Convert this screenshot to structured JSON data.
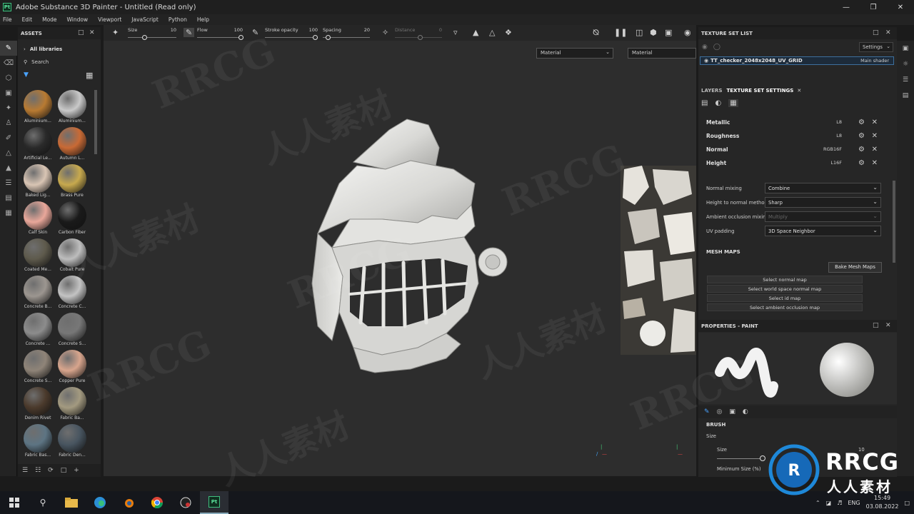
{
  "window": {
    "title": "Adobe Substance 3D Painter - Untitled (Read only)",
    "app_icon": "Pt"
  },
  "menu": [
    "File",
    "Edit",
    "Mode",
    "Window",
    "Viewport",
    "JavaScript",
    "Python",
    "Help"
  ],
  "toolbar": {
    "size_label": "Size",
    "size_value": "10",
    "flow_label": "Flow",
    "flow_value": "100",
    "stroke_opacity_label": "Stroke opacity",
    "stroke_opacity_value": "100",
    "spacing_label": "Spacing",
    "spacing_value": "20",
    "distance_label": "Distance",
    "distance_value": "0"
  },
  "viewport": {
    "material_select_3d": "Material",
    "material_select_2d": "Material"
  },
  "assets": {
    "title": "ASSETS",
    "libraries_label": "All libraries",
    "search_placeholder": "Search",
    "items": [
      {
        "label": "Aluminium...",
        "color": "#b87a32"
      },
      {
        "label": "Aluminium...",
        "color": "#c9c9c9"
      },
      {
        "label": "Artificial Le...",
        "color": "#2a2a2a"
      },
      {
        "label": "Autumn L...",
        "color": "#c96a35"
      },
      {
        "label": "Baked Lig...",
        "color": "#d9c5b4"
      },
      {
        "label": "Brass Pure",
        "color": "#c7a94e"
      },
      {
        "label": "Calf Skin",
        "color": "#e9a79a"
      },
      {
        "label": "Carbon Fiber",
        "color": "#1a1a1a"
      },
      {
        "label": "Coated Me...",
        "color": "#5e5a4c"
      },
      {
        "label": "Cobalt Pure",
        "color": "#bdbdbd"
      },
      {
        "label": "Concrete B...",
        "color": "#9c9690"
      },
      {
        "label": "Concrete C...",
        "color": "#c3c3c3"
      },
      {
        "label": "Concrete ...",
        "color": "#8c8c8c"
      },
      {
        "label": "Concrete S...",
        "color": "#777777"
      },
      {
        "label": "Concrete S...",
        "color": "#8f8478"
      },
      {
        "label": "Copper Pure",
        "color": "#d8a58d"
      },
      {
        "label": "Denim Rivet",
        "color": "#4b3a2c"
      },
      {
        "label": "Fabric Ba...",
        "color": "#a39a80"
      },
      {
        "label": "Fabric Bas...",
        "color": "#5d7483"
      },
      {
        "label": "Fabric Den...",
        "color": "#485560"
      }
    ]
  },
  "texture_set_list": {
    "title": "TEXTURE SET LIST",
    "settings_label": "Settings",
    "item_name": "TT_checker_2048x2048_UV_GRID",
    "item_shader": "Main shader"
  },
  "tabs": {
    "layers": "LAYERS",
    "texture_set_settings": "TEXTURE SET SETTINGS"
  },
  "channels": [
    {
      "name": "Metallic",
      "format": "L8"
    },
    {
      "name": "Roughness",
      "format": "L8"
    },
    {
      "name": "Normal",
      "format": "RGB16F"
    },
    {
      "name": "Height",
      "format": "L16F"
    }
  ],
  "properties": {
    "normal_mixing_label": "Normal mixing",
    "normal_mixing_value": "Combine",
    "height_to_normal_label": "Height to normal method",
    "height_to_normal_value": "Sharp",
    "ao_mixing_label": "Ambient occlusion mixing",
    "ao_mixing_value": "Multiply",
    "uv_padding_label": "UV padding",
    "uv_padding_value": "3D Space Neighbor"
  },
  "mesh_maps": {
    "title": "MESH MAPS",
    "bake_button": "Bake Mesh Maps",
    "buttons": [
      "Select normal map",
      "Select world space normal map",
      "Select id map",
      "Select ambient occlusion map"
    ]
  },
  "paint_properties": {
    "title": "PROPERTIES - PAINT",
    "brush_section": "BRUSH",
    "size_label": "Size",
    "size_slider_label": "Size",
    "size_value": "10",
    "min_size_label": "Minimum Size (%)"
  },
  "taskbar": {
    "language": "ENG",
    "time": "15:49",
    "date": "03.08.2022"
  },
  "watermark": {
    "brand": "RRCG",
    "cn_text": "人人素材"
  },
  "logo": {
    "brand": "RRCG",
    "subtitle": "人人素材"
  }
}
